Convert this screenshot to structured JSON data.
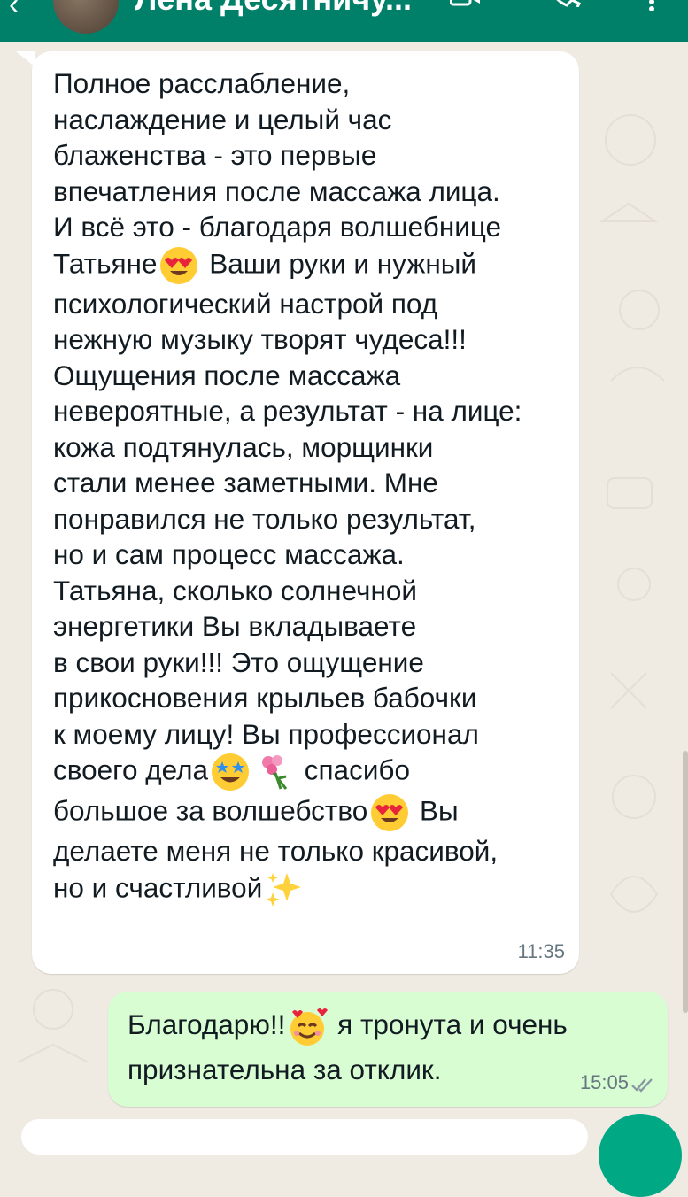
{
  "header": {
    "title": "Лена Десятничу...",
    "icons": [
      "back-arrow-icon",
      "video-call-icon",
      "phone-call-icon",
      "menu-icon"
    ],
    "color": "#008069"
  },
  "messages": [
    {
      "direction": "incoming",
      "text_lines": [
        "Полное расслабление,",
        "наслаждение и целый час",
        "блаженства - это первые",
        "впечатления после массажа лица.",
        "И всё это -  благодаря волшебнице",
        "Татьяне",
        " Ваши руки и нужный",
        "психологический настрой под",
        "нежную музыку  творят чудеса!!!",
        "Ощущения после массажа",
        "невероятные, а результат - на лице:",
        "кожа подтянулась, морщинки",
        "стали менее заметными. Мне",
        "понравился не только результат,",
        "но и сам процесс массажа.",
        "Татьяна, сколько солнечной",
        "энергетики Вы вкладываете",
        "в свои руки!!! Это ощущение",
        "прикосновения крыльев бабочки",
        "к моему лицу! Вы профессионал",
        "своего дела",
        " спасибо",
        "большое за волшебство",
        " Вы",
        "делаете меня не только красивой,",
        "но и счастливой"
      ],
      "emojis": [
        "heart-eyes-emoji",
        "star-struck-emoji",
        "bouquet-emoji",
        "heart-eyes-emoji",
        "sparkles-emoji"
      ],
      "time": "11:35"
    },
    {
      "direction": "outgoing",
      "text_lines": [
        "Благодарю!!",
        " я тронута и очень",
        "признательна за отклик."
      ],
      "emojis": [
        "smiling-hearts-emoji"
      ],
      "time": "15:05",
      "status": "delivered"
    }
  ],
  "colors": {
    "chat_background": "#efeae2",
    "incoming_bubble": "#ffffff",
    "outgoing_bubble": "#d9fdd3",
    "accent": "#00a884"
  }
}
